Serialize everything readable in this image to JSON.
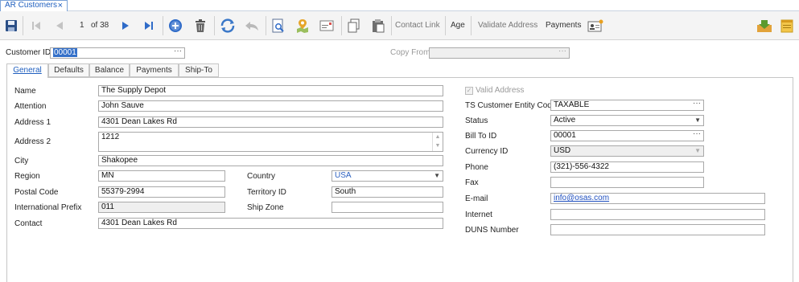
{
  "document_tab": {
    "title": "AR Customers",
    "close": "×"
  },
  "toolbar": {
    "record_position": "1",
    "record_total": "of 38",
    "contact_link": "Contact Link",
    "age": "Age",
    "validate_address": "Validate Address",
    "payments": "Payments"
  },
  "header": {
    "customer_id_label": "Customer ID",
    "customer_id_value": "00001",
    "copy_from_label": "Copy From",
    "copy_from_value": ""
  },
  "tabs": [
    "General",
    "Defaults",
    "Balance",
    "Payments",
    "Ship-To"
  ],
  "left": {
    "name_label": "Name",
    "name": "The Supply Depot",
    "attention_label": "Attention",
    "attention": "John Sauve",
    "address1_label": "Address 1",
    "address1": "4301 Dean Lakes Rd",
    "address2_label": "Address 2",
    "address2": "1212",
    "city_label": "City",
    "city": "Shakopee",
    "region_label": "Region",
    "region": "MN",
    "postal_label": "Postal Code",
    "postal": "55379-2994",
    "intl_prefix_label": "International Prefix",
    "intl_prefix": "011",
    "contact_label": "Contact",
    "contact": "4301 Dean Lakes Rd",
    "country_label": "Country",
    "country": "USA",
    "territory_label": "Territory ID",
    "territory": "South",
    "shipzone_label": "Ship Zone",
    "shipzone": ""
  },
  "right": {
    "valid_address_label": "Valid Address",
    "entity_code_label": "TS Customer Entity Code",
    "entity_code": "TAXABLE",
    "status_label": "Status",
    "status": "Active",
    "bill_to_label": "Bill To ID",
    "bill_to": "00001",
    "currency_label": "Currency ID",
    "currency": "USD",
    "phone_label": "Phone",
    "phone": "(321)-556-4322",
    "fax_label": "Fax",
    "fax": "",
    "email_label": "E-mail",
    "email": "info@osas.com",
    "internet_label": "Internet",
    "internet": "",
    "duns_label": "DUNS Number",
    "duns": ""
  },
  "colors": {
    "accent": "#1f5fbf",
    "tab_border": "#7aa2d6"
  }
}
